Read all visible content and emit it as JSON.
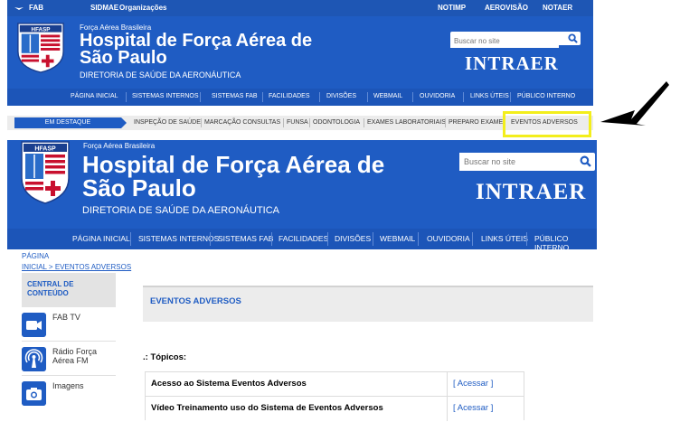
{
  "shot1": {
    "topbar": {
      "fab": "FAB",
      "sidmae": "SIDMAE",
      "organizacoes": "Organizações",
      "notimp": "NOTIMP",
      "aerovisao": "AEROVISÃO",
      "notaer": "NOTAER"
    },
    "header": {
      "org": "Força Aérea Brasileira",
      "title_line1": "Hospital de Força Aérea de",
      "title_line2": "São Paulo",
      "subtitle": "DIRETORIA DE SAÚDE DA AERONÁUTICA",
      "search_placeholder": "Buscar no site",
      "intraer": "INTRAER",
      "logo_text": "HFASP"
    },
    "nav": [
      "PÁGINA INICIAL",
      "SISTEMAS INTERNOS",
      "SISTEMAS FAB",
      "FACILIDADES",
      "DIVISÕES",
      "WEBMAIL",
      "OUVIDORIA",
      "LINKS ÚTEIS",
      "PÚBLICO INTERNO"
    ],
    "featured_label": "EM DESTAQUE",
    "featured_items": [
      "INSPEÇÃO DE SAÚDE",
      "MARCAÇÃO CONSULTAS",
      "FUNSA",
      "ODONTOLOGIA",
      "EXAMES LABORATORIAIS",
      "PREPARO EXAME",
      "EVENTOS ADVERSOS"
    ]
  },
  "shot2": {
    "header": {
      "org": "Força Aérea Brasileira",
      "title_line1": "Hospital de Força Aérea de",
      "title_line2": "São Paulo",
      "subtitle": "DIRETORIA DE SAÚDE DA AERONÁUTICA",
      "search_placeholder": "Buscar no site",
      "intraer": "INTRAER",
      "logo_text": "HFASP"
    },
    "nav": [
      "PÁGINA INICIAL",
      "SISTEMAS INTERNOS",
      "SISTEMAS FAB",
      "FACILIDADES",
      "DIVISÕES",
      "WEBMAIL",
      "OUVIDORIA",
      "LINKS ÚTEIS",
      "PÚBLICO INTERNO"
    ],
    "breadcrumb": {
      "line1": "PÁGINA",
      "line2": "INICIAL > EVENTOS ADVERSOS"
    },
    "sidebar": {
      "central": "CENTRAL DE CONTEÚDO",
      "items": [
        "FAB TV",
        "Rádio Força Aérea FM",
        "Imagens"
      ]
    },
    "panel_title": "EVENTOS ADVERSOS",
    "topics_heading": ".: Tópicos:",
    "rows": [
      {
        "label": "Acesso ao Sistema Eventos Adversos",
        "bracket_open": "[",
        "link": "Acessar",
        "bracket_close": "]"
      },
      {
        "label": "Vídeo Treinamento uso do Sistema de Eventos Adversos",
        "bracket_open": "[",
        "link": "Acessar",
        "bracket_close": "]"
      }
    ]
  },
  "colors": {
    "brand_blue": "#1f5cc3",
    "highlight_yellow": "#f3ee1c",
    "arrow": "#000000"
  }
}
